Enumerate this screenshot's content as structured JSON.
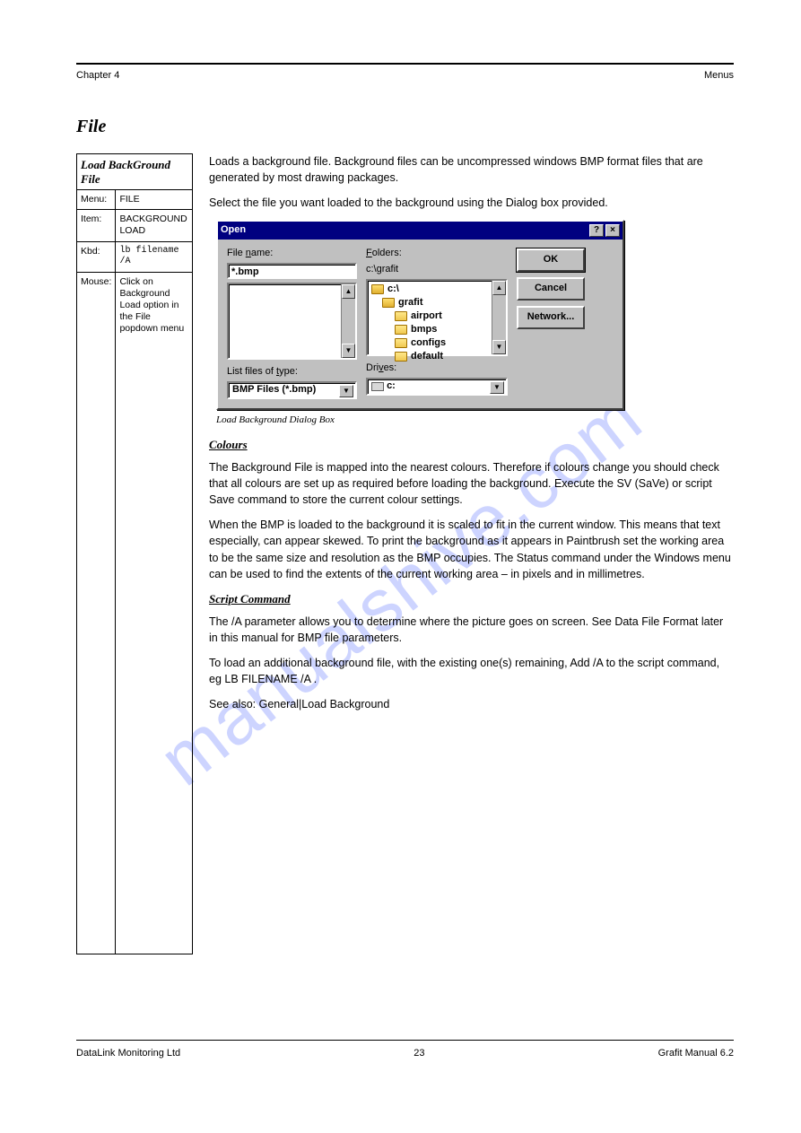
{
  "header": {
    "left": "Chapter 4",
    "right": "Menus"
  },
  "section_title": "File",
  "sidebar": {
    "header": "Load BackGround File",
    "rows": [
      {
        "k": "Menu:",
        "v": "FILE"
      },
      {
        "k": "Item:",
        "v": "BACKGROUND LOAD"
      },
      {
        "k": "Kbd:",
        "v_cmd": "lb filename /A"
      },
      {
        "k": "Mouse:",
        "v": "Click on Background Load option in the File popdown menu"
      }
    ]
  },
  "main": {
    "p1": "Loads a background file.  Background files can be uncompressed windows BMP format files that are generated by most drawing packages.",
    "p2": "Select the file you want loaded to the background using the Dialog box provided.",
    "fig_caption": "Load Background Dialog Box",
    "h1": "Colours",
    "p3": "The Background File is mapped into the nearest colours.  Therefore if colours change you should check that all colours are set up as required before loading the background. Execute the SV (SaVe) or script Save command to store the current colour settings.",
    "p4": "When the BMP is loaded to the background it is scaled to fit in the current window.  This means that text especially, can appear skewed. To print the background as it appears in Paintbrush set the working area to be the same size and resolution as the BMP occupies. The Status command under the Windows menu can be used to find the extents of the current working area – in pixels and in millimetres.",
    "h2": "Script Command",
    "p5": "The /A parameter allows you to determine where the picture goes on screen. See Data File Format later in this manual for BMP file parameters.",
    "p6": "To load an additional background file, with the existing one(s) remaining, Add /A to the script command, eg LB FILENAME /A .",
    "p7": "See also: General|Load Background"
  },
  "dialog": {
    "title": "Open",
    "filename_label": "File name:",
    "filename_value": "*.bmp",
    "folders_label": "Folders:",
    "folders_path": "c:\\grafit",
    "listtype_label": "List files of type:",
    "listtype_value": "BMP Files (*.bmp)",
    "drives_label": "Drives:",
    "drives_value": "c:",
    "folders": [
      {
        "name": "c:\\",
        "indent": 0,
        "open": true
      },
      {
        "name": "grafit",
        "indent": 1,
        "open": true
      },
      {
        "name": "airport",
        "indent": 2,
        "open": false
      },
      {
        "name": "bmps",
        "indent": 2,
        "open": false
      },
      {
        "name": "configs",
        "indent": 2,
        "open": false
      },
      {
        "name": "default",
        "indent": 2,
        "open": false
      }
    ],
    "buttons": {
      "ok": "OK",
      "cancel": "Cancel",
      "network": "Network..."
    },
    "help": "?",
    "close": "×"
  },
  "footer": {
    "left": "DataLink Monitoring Ltd",
    "center": "23",
    "right": "Grafit Manual 6.2"
  },
  "watermark": "manualshive.com"
}
